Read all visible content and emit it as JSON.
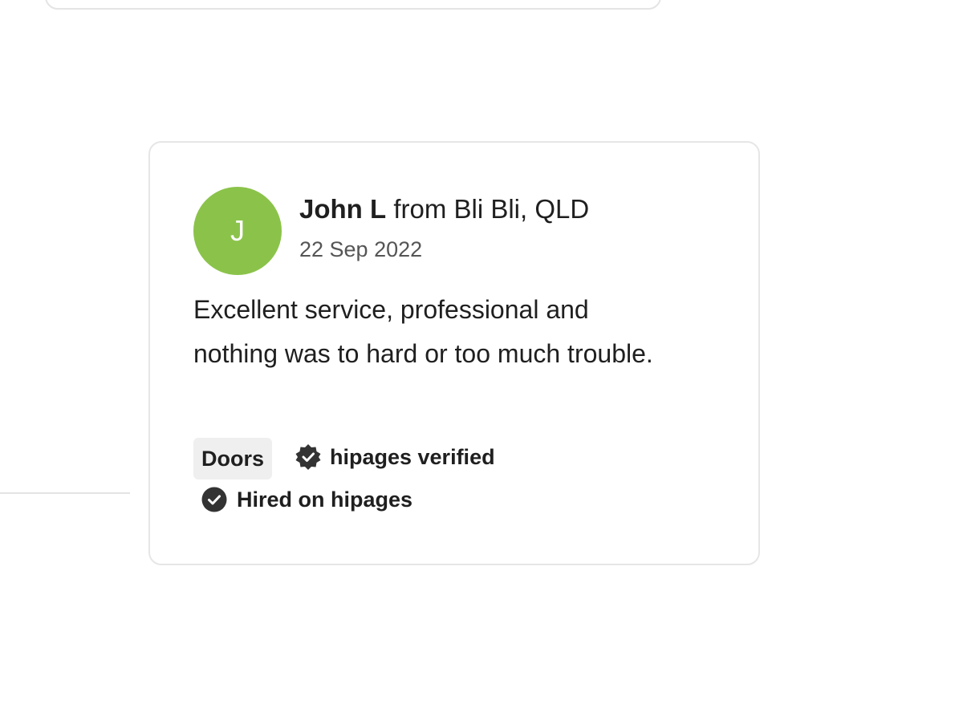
{
  "review": {
    "avatar_initial": "J",
    "avatar_color": "#8bc34a",
    "reviewer_name": "John L",
    "reviewer_location": " from Bli Bli, QLD",
    "date": "22 Sep 2022",
    "text": "Excellent service, professional and nothing was to hard or too much trouble.",
    "tag": "Doors",
    "verified_label": "hipages verified",
    "verified_icon": "verified-badge-icon",
    "hired_label": "Hired on hipages",
    "hired_icon": "check-circle-icon"
  }
}
